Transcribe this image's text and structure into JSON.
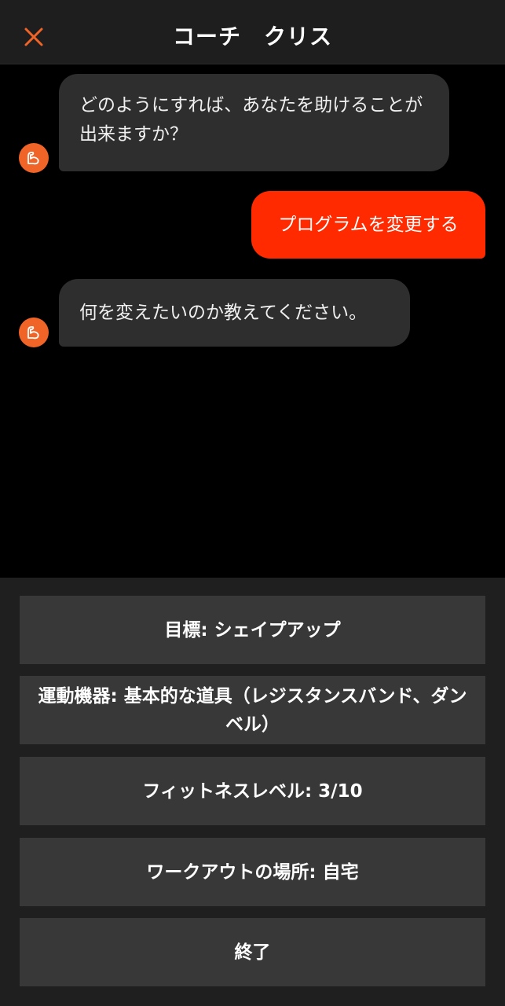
{
  "header": {
    "title": "コーチ　クリス"
  },
  "messages": [
    {
      "sender": "coach",
      "text": "どのようにすれば、あなたを助けることが出来ますか？"
    },
    {
      "sender": "user",
      "text": "プログラムを変更する"
    },
    {
      "sender": "coach",
      "text": "何を変えたいのか教えてください。"
    }
  ],
  "options": [
    {
      "label": "目標: シェイプアップ"
    },
    {
      "label": "運動機器: 基本的な道具（レジスタンスバンド、ダンベル）"
    },
    {
      "label": "フィットネスレベル: 3/10"
    },
    {
      "label": "ワークアウトの場所: 自宅"
    },
    {
      "label": "終了"
    }
  ],
  "colors": {
    "accent": "#f06428",
    "user_bubble": "#ff2a00",
    "coach_bubble": "#2e2e2e",
    "option_bg": "#383838",
    "panel_bg": "#1f1f1f",
    "header_bg": "#1e1e1e"
  },
  "icons": {
    "close": "close-icon",
    "avatar": "flexed-arm-icon"
  }
}
